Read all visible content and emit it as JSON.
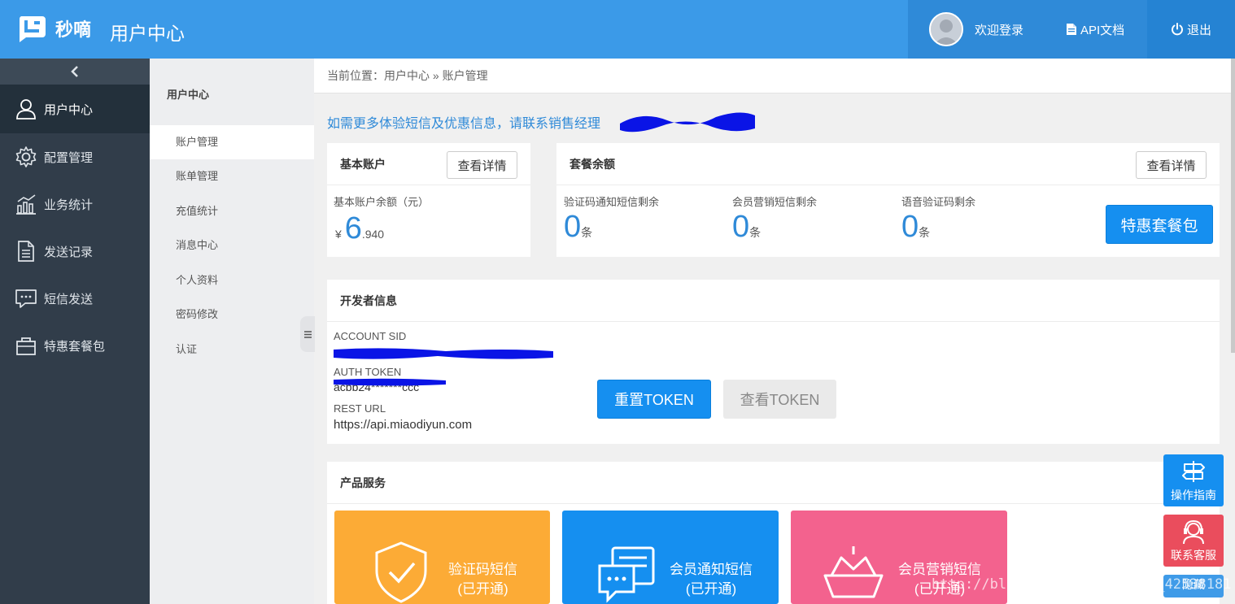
{
  "brand": {
    "name": "秒嘀"
  },
  "header": {
    "title": "用户中心",
    "user_link": "欢迎登录",
    "api_link": "API文档",
    "logout": "退出"
  },
  "sidebar": {
    "items": [
      {
        "label": "用户中心",
        "icon": "user-icon",
        "active": true
      },
      {
        "label": "配置管理",
        "icon": "gear-icon"
      },
      {
        "label": "业务统计",
        "icon": "bar-chart-icon"
      },
      {
        "label": "发送记录",
        "icon": "document-icon"
      },
      {
        "label": "短信发送",
        "icon": "chat-icon"
      },
      {
        "label": "特惠套餐包",
        "icon": "bag-icon"
      }
    ]
  },
  "subnav": {
    "title": "用户中心",
    "items": [
      {
        "label": "账户管理",
        "active": true
      },
      {
        "label": "账单管理"
      },
      {
        "label": "充值统计"
      },
      {
        "label": "消息中心"
      },
      {
        "label": "个人资料"
      },
      {
        "label": "密码修改"
      },
      {
        "label": "认证"
      }
    ]
  },
  "breadcrumb": "当前位置：用户中心 » 账户管理",
  "notice": "如需更多体验短信及优惠信息，请联系销售经理",
  "basic_account": {
    "title": "基本账户",
    "detail_button": "查看详情",
    "balance_label": "基本账户余额（元）",
    "currency": "¥",
    "balance_int": "6",
    "balance_dec": ".940"
  },
  "package": {
    "title": "套餐余额",
    "detail_button": "查看详情",
    "promo_button": "特惠套餐包",
    "items": [
      {
        "label": "验证码通知短信剩余",
        "value": "0",
        "unit": "条"
      },
      {
        "label": "会员营销短信剩余",
        "value": "0",
        "unit": "条"
      },
      {
        "label": "语音验证码剩余",
        "value": "0",
        "unit": "条"
      }
    ]
  },
  "developer": {
    "title": "开发者信息",
    "sid_label": "ACCOUNT SID",
    "token_label": "AUTH TOKEN",
    "token_value": "acbb24*******ccc",
    "url_label": "REST URL",
    "url_value": "https://api.miaodiyun.com",
    "reset_button": "重置TOKEN",
    "view_button": "查看TOKEN"
  },
  "products": {
    "title": "产品服务",
    "items": [
      {
        "name": "验证码短信",
        "status": "(已开通)",
        "color": "#fcab36",
        "icon": "shield-check-icon"
      },
      {
        "name": "会员通知短信",
        "status": "(已开通)",
        "color": "#158ff0",
        "icon": "message-window-icon"
      },
      {
        "name": "会员营销短信",
        "status": "(已开通)",
        "color": "#f3628e",
        "icon": "crown-icon"
      }
    ]
  },
  "floating": {
    "guide": "操作指南",
    "service": "联系客服",
    "hide": "隐藏"
  },
  "watermark": "http://blog.csdn.net/weixin_42538181",
  "colors": {
    "topbar": "#3b9ae8",
    "sidebar": "#313d4a",
    "accent": "#2f8ad8",
    "primary_button": "#158ff0"
  }
}
